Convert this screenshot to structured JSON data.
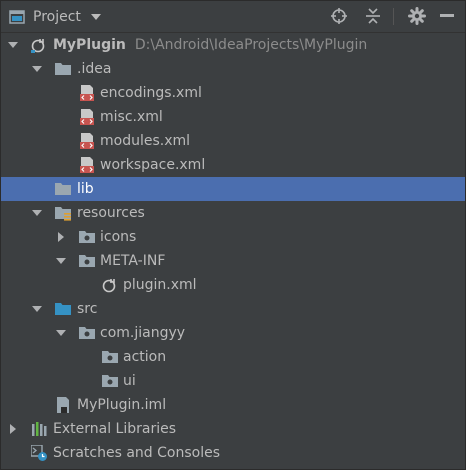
{
  "header": {
    "title": "Project",
    "icons": [
      "project-view-icon",
      "chevron-down-icon",
      "locate-icon",
      "collapse-all-icon",
      "gear-icon",
      "hide-panel-icon"
    ]
  },
  "tree": {
    "root": {
      "label": "MyPlugin",
      "path": "D:\\Android\\IdeaProjects\\MyPlugin"
    },
    "idea_folder": "idea",
    "idea_folder_prefix": ".",
    "encodings": "encodings.xml",
    "misc": "misc.xml",
    "modules": "modules.xml",
    "workspace": "workspace.xml",
    "lib": "lib",
    "resources": "resources",
    "icons": "icons",
    "meta_inf": "META-INF",
    "plugin_xml": "plugin.xml",
    "src": "src",
    "package": "com.jiangyy",
    "action": "action",
    "ui": "ui",
    "iml": "MyPlugin.iml",
    "external_libraries": "External Libraries",
    "scratches": "Scratches and Consoles"
  },
  "colors": {
    "background": "#3c3f41",
    "selection": "#4b6eaf",
    "text": "#bbbbbb",
    "folder": "#9aa7b0",
    "source_folder": "#3592c4",
    "xml_icon": "#c75450"
  }
}
